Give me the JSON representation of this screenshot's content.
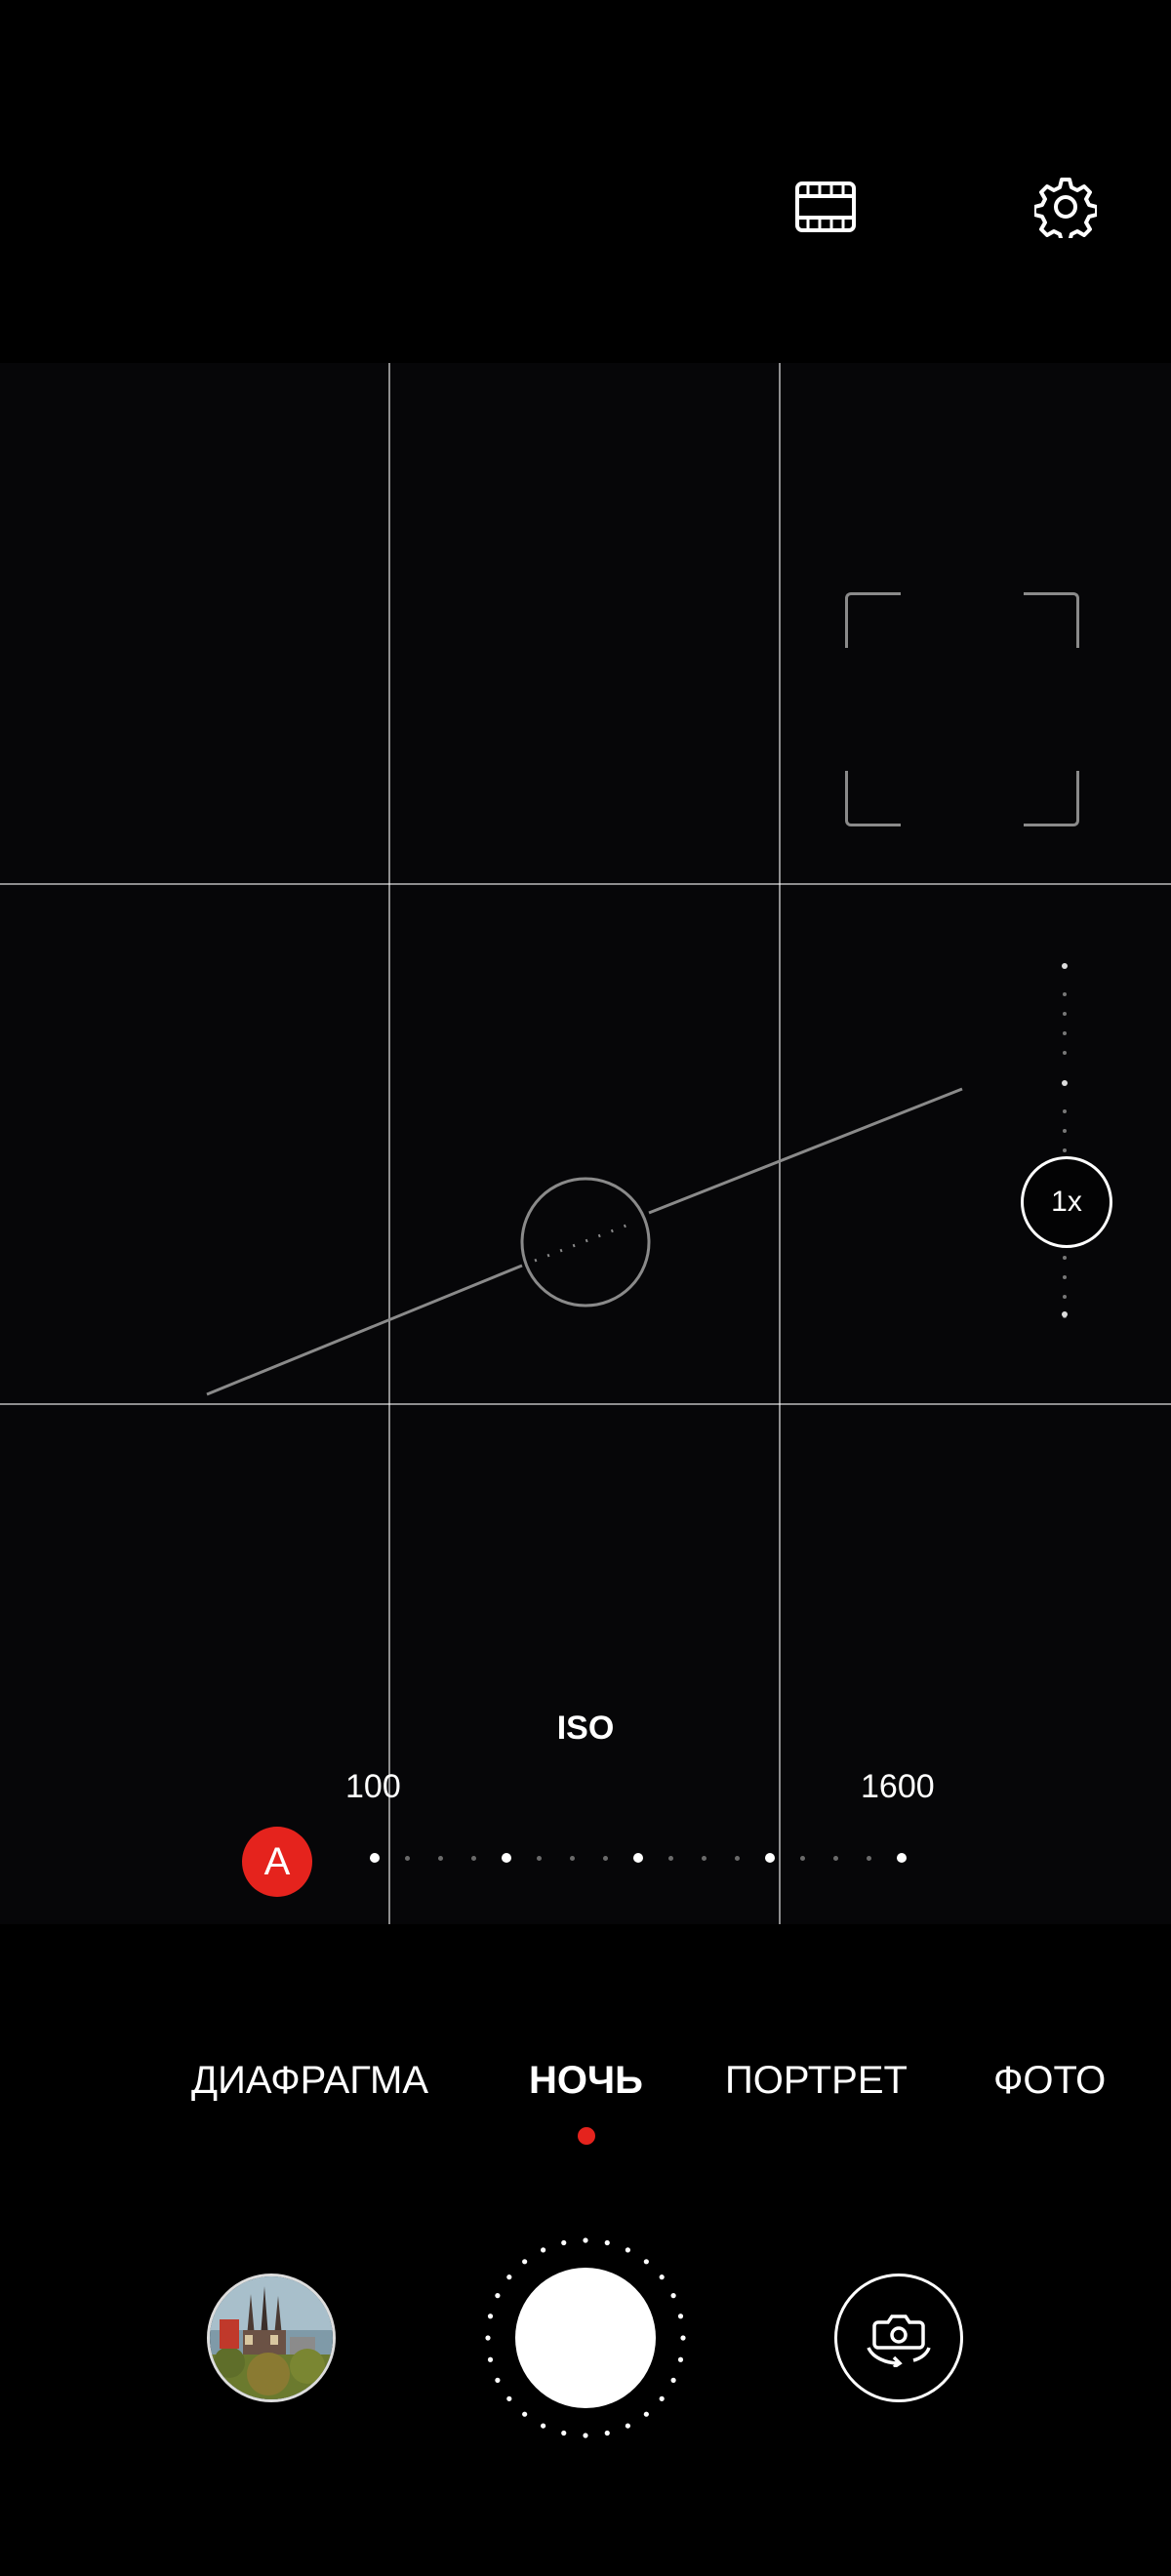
{
  "topbar": {
    "video_mode_icon": "film-icon",
    "settings_icon": "gear-icon"
  },
  "viewfinder": {
    "focus_frame_icon": "focus-frame-icon",
    "zoom": {
      "label": "1x"
    },
    "level_indicator": "level-icon"
  },
  "iso": {
    "title": "ISO",
    "min_label": "100",
    "max_label": "1600",
    "auto_label": "A",
    "auto_color": "#e5231d"
  },
  "modes": {
    "items": [
      {
        "label": "ДИАФРАГМА",
        "active": false
      },
      {
        "label": "НОЧЬ",
        "active": true
      },
      {
        "label": "ПОРТРЕТ",
        "active": false
      },
      {
        "label": "ФОТО",
        "active": false
      }
    ],
    "active_indicator_color": "#e5231d"
  },
  "controls": {
    "gallery_icon": "gallery-thumbnail-icon",
    "shutter_icon": "shutter-icon",
    "switch_camera_icon": "switch-camera-icon"
  }
}
